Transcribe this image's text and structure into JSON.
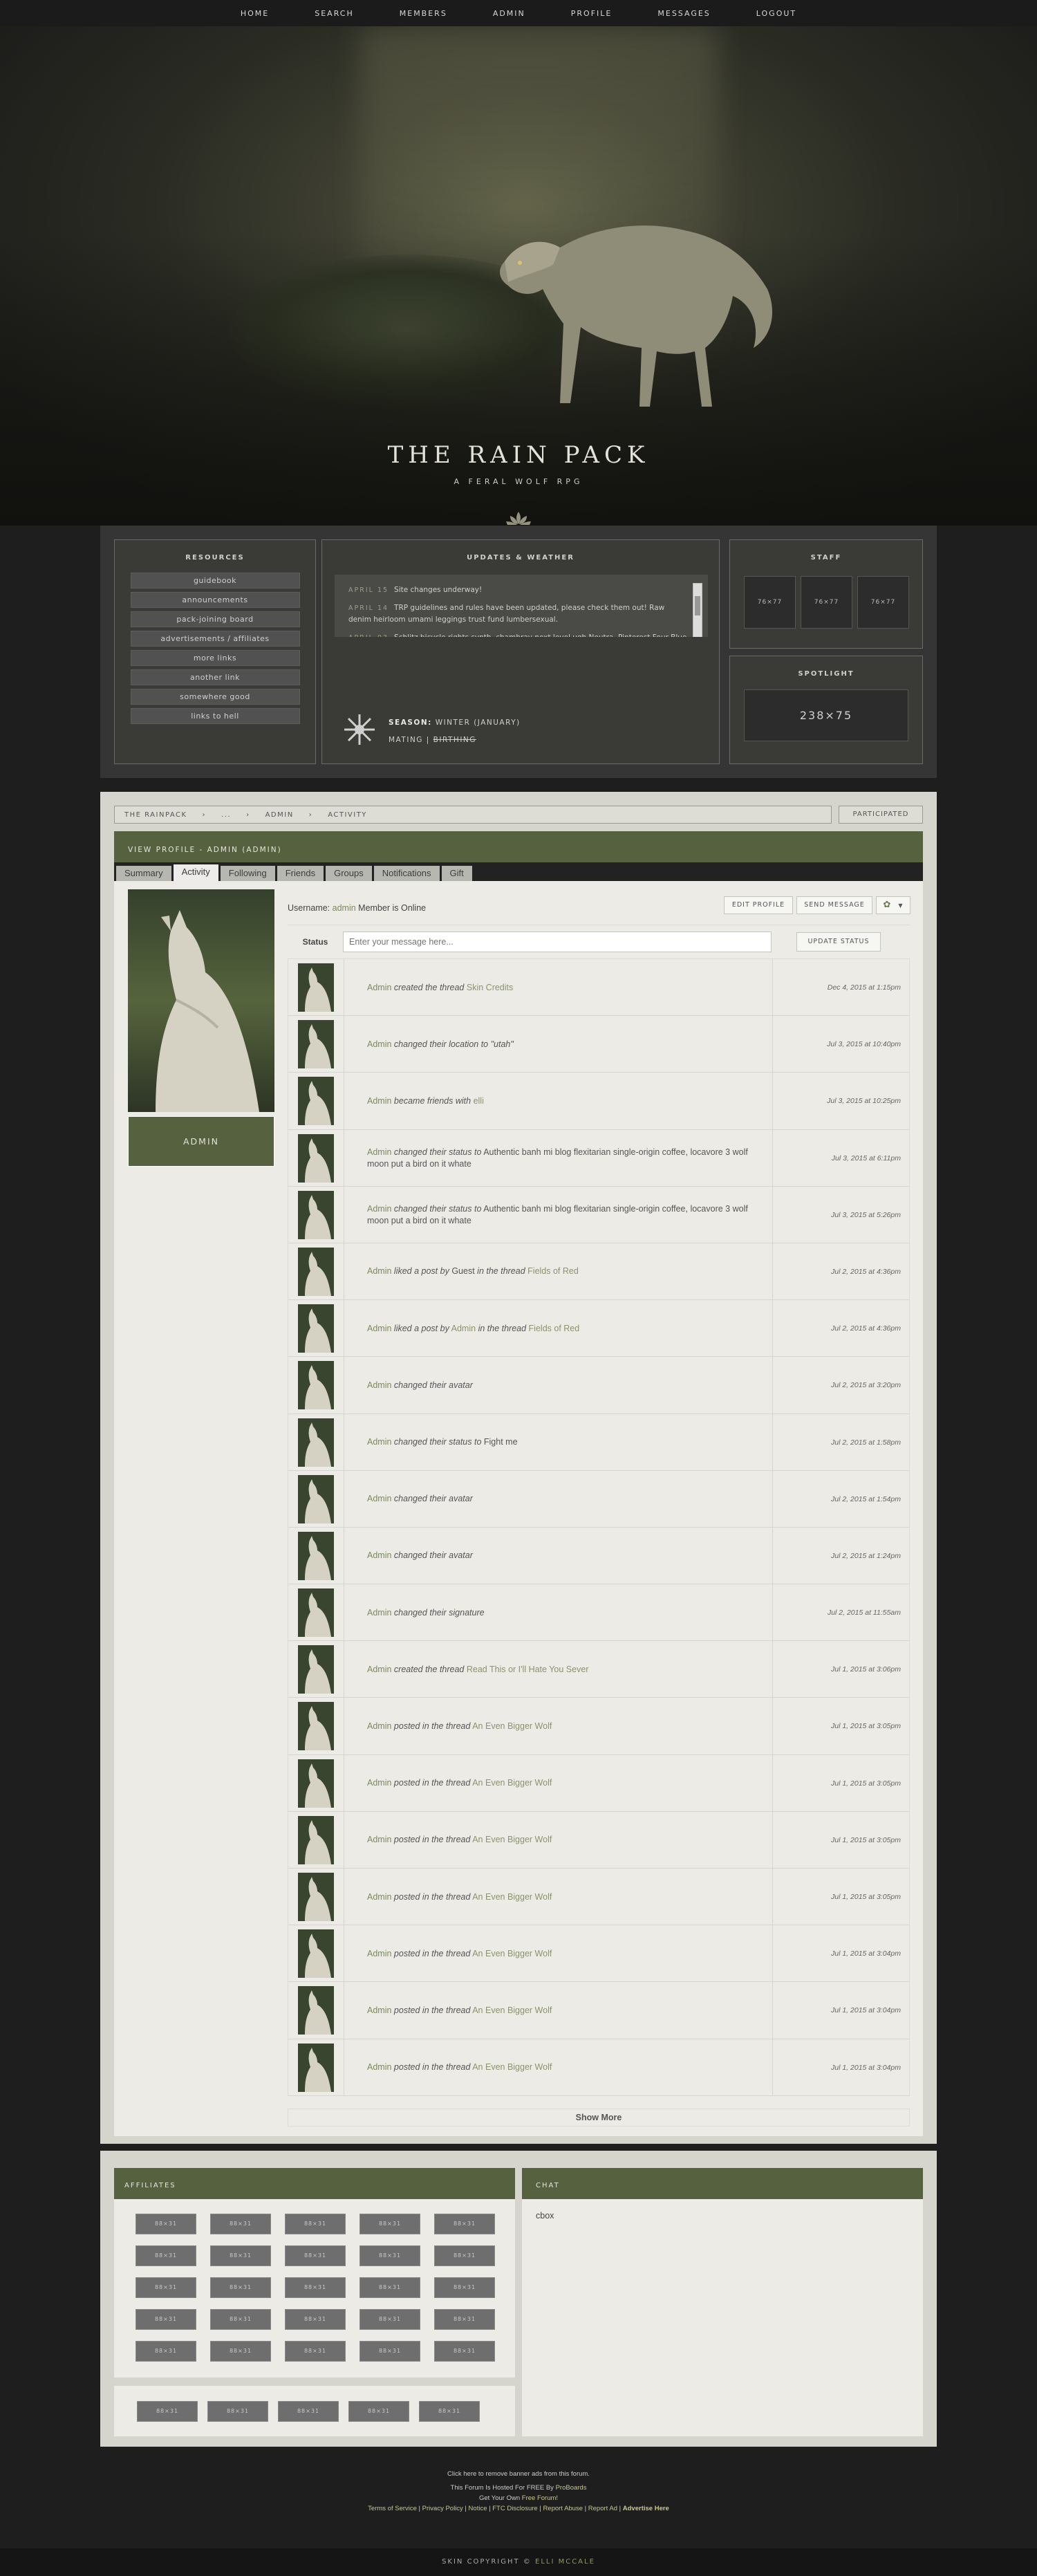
{
  "nav": [
    "HOME",
    "SEARCH",
    "MEMBERS",
    "ADMIN",
    "PROFILE",
    "MESSAGES",
    "LOGOUT"
  ],
  "header": {
    "title": "THE RAIN PACK",
    "subtitle": "A FERAL WOLF RPG"
  },
  "resources": {
    "title": "RESOURCES",
    "links": [
      "guidebook",
      "announcements",
      "pack-joining board",
      "advertisements / affiliates",
      "more links",
      "another link",
      "somewhere good",
      "links to hell"
    ]
  },
  "updates": {
    "title": "UPDATES & WEATHER",
    "items": [
      {
        "date": "APRIL 15",
        "text": "Site changes underway!"
      },
      {
        "date": "APRIL 14",
        "text": "TRP guidelines and rules have been updated, please check them out! Raw denim heirloom umami leggings trust fund lumbersexual."
      },
      {
        "date": "APRIL 03",
        "text": "Schlitz bicycle rights synth, chambray next level ugh Neutra. Pinterest Four Blue Bottle. Carles four dollar toast tilde raw denim McSweeney's ennui."
      }
    ],
    "season_label": "SEASON:",
    "season_value": "WINTER (JANUARY)",
    "mating_label": "MATING",
    "mating_sep": "|",
    "mating_value": "BIRTHING"
  },
  "staff": {
    "title": "STAFF",
    "avatars": [
      "76×77",
      "76×77",
      "76×77"
    ]
  },
  "spotlight": {
    "title": "SPOTLIGHT",
    "image": "238×75"
  },
  "breadcrumb": [
    "THE RAINPACK",
    "›",
    "...",
    "›",
    "ADMIN",
    "›",
    "ACTIVITY"
  ],
  "participated": "PARTICIPATED",
  "profile": {
    "title": "VIEW PROFILE - ADMIN (ADMIN)",
    "tabs": [
      "Summary",
      "Activity",
      "Following",
      "Friends",
      "Groups",
      "Notifications",
      "Gift"
    ],
    "active_tab": "Activity",
    "username_label": "Username:",
    "username": "admin",
    "online": "Member is Online",
    "avatar_name": "ADMIN",
    "edit_btn": "EDIT PROFILE",
    "send_btn": "SEND MESSAGE",
    "status_label": "Status",
    "status_placeholder": "Enter your message here...",
    "update_status_btn": "UPDATE STATUS",
    "show_more": "Show More"
  },
  "feed": [
    {
      "who": "Admin",
      "act": "created the thread",
      "tgt": "Skin Credits",
      "date": "Dec 4, 2015 at 1:15pm"
    },
    {
      "who": "Admin",
      "act": "changed their location to \"utah\"",
      "tgt": "",
      "date": "Jul 3, 2015 at 10:40pm"
    },
    {
      "who": "Admin",
      "act": "became friends with",
      "tgt": "elli",
      "date": "Jul 3, 2015 at 10:25pm"
    },
    {
      "who": "Admin",
      "act": "changed their status to",
      "tgt": "",
      "plain": "Authentic banh mi blog flexitarian single-origin coffee, locavore 3 wolf moon put a bird on it whate",
      "date": "Jul 3, 2015 at 6:11pm"
    },
    {
      "who": "Admin",
      "act": "changed their status to",
      "tgt": "",
      "plain": "Authentic banh mi blog flexitarian single-origin coffee, locavore 3 wolf moon put a bird on it whate",
      "date": "Jul 3, 2015 at 5:26pm"
    },
    {
      "who": "Admin",
      "act": "liked a post by",
      "tgt": "",
      "plain": "Guest",
      "act2": "in the thread",
      "tgt2": "Fields of Red",
      "date": "Jul 2, 2015 at 4:36pm"
    },
    {
      "who": "Admin",
      "act": "liked a post by",
      "tgt": "Admin",
      "act2": "in the thread",
      "tgt2": "Fields of Red",
      "date": "Jul 2, 2015 at 4:36pm"
    },
    {
      "who": "Admin",
      "act": "changed their avatar",
      "tgt": "",
      "date": "Jul 2, 2015 at 3:20pm"
    },
    {
      "who": "Admin",
      "act": "changed their status to",
      "tgt": "",
      "plain": "Fight me",
      "date": "Jul 2, 2015 at 1:58pm"
    },
    {
      "who": "Admin",
      "act": "changed their avatar",
      "tgt": "",
      "date": "Jul 2, 2015 at 1:54pm"
    },
    {
      "who": "Admin",
      "act": "changed their avatar",
      "tgt": "",
      "date": "Jul 2, 2015 at 1:24pm"
    },
    {
      "who": "Admin",
      "act": "changed their signature",
      "tgt": "",
      "date": "Jul 2, 2015 at 11:55am"
    },
    {
      "who": "Admin",
      "act": "created the thread",
      "tgt": "Read This or I'll Hate You Sever",
      "date": "Jul 1, 2015 at 3:06pm"
    },
    {
      "who": "Admin",
      "act": "posted in the thread",
      "tgt": "An Even Bigger Wolf",
      "date": "Jul 1, 2015 at 3:05pm"
    },
    {
      "who": "Admin",
      "act": "posted in the thread",
      "tgt": "An Even Bigger Wolf",
      "date": "Jul 1, 2015 at 3:05pm"
    },
    {
      "who": "Admin",
      "act": "posted in the thread",
      "tgt": "An Even Bigger Wolf",
      "date": "Jul 1, 2015 at 3:05pm"
    },
    {
      "who": "Admin",
      "act": "posted in the thread",
      "tgt": "An Even Bigger Wolf",
      "date": "Jul 1, 2015 at 3:05pm"
    },
    {
      "who": "Admin",
      "act": "posted in the thread",
      "tgt": "An Even Bigger Wolf",
      "date": "Jul 1, 2015 at 3:04pm"
    },
    {
      "who": "Admin",
      "act": "posted in the thread",
      "tgt": "An Even Bigger Wolf",
      "date": "Jul 1, 2015 at 3:04pm"
    },
    {
      "who": "Admin",
      "act": "posted in the thread",
      "tgt": "An Even Bigger Wolf",
      "date": "Jul 1, 2015 at 3:04pm"
    }
  ],
  "affiliates": {
    "title": "AFFILIATES",
    "button": "88×31",
    "rows": 5,
    "cols": 5,
    "row2_count": 5
  },
  "chat": {
    "title": "CHAT",
    "body": "cbox"
  },
  "footer": {
    "line1": "Click here to remove banner ads from this forum.",
    "line2a": "This Forum Is Hosted For FREE By",
    "line2b": "ProBoards",
    "line3a": "Get Your Own",
    "line3b": "Free Forum!",
    "links": [
      "Terms of Service",
      "Privacy Policy",
      "Notice",
      "FTC Disclosure",
      "Report Abuse",
      "Report Ad",
      "Advertise Here"
    ],
    "copyright": "SKIN COPYRIGHT ©",
    "author": "ELLI MCCALE"
  },
  "colors": {
    "accent": "#56613f",
    "link": "#7b8a5a",
    "bg": "#1e1e1e",
    "panel": "#d6d5cd"
  }
}
